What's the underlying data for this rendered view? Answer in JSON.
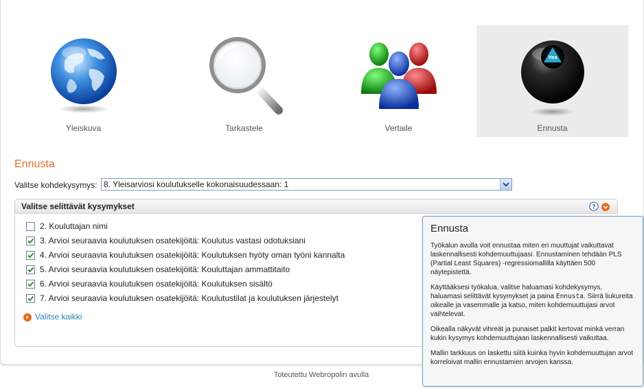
{
  "nav": [
    {
      "label": "Yleiskuva",
      "icon": "globe-icon",
      "active": false
    },
    {
      "label": "Tarkastele",
      "icon": "magnifier-icon",
      "active": false
    },
    {
      "label": "Vertaile",
      "icon": "people-icon",
      "active": false
    },
    {
      "label": "Ennusta",
      "icon": "eight-ball-icon",
      "active": true
    }
  ],
  "eight_ball_text": "Yes",
  "section_title": "Ennusta",
  "target": {
    "label": "Valitse kohdekysymys:",
    "selected": "8. Yleisarviosi koulutukselle kokonaisuudessaan: 1"
  },
  "questions_box": {
    "title": "Valitse selittävät kysymykset",
    "items": [
      {
        "label": "2. Kouluttajan nimi",
        "checked": false
      },
      {
        "label": "3. Arvioi seuraavia koulutuksen osatekijöitä: Koulutus vastasi odotuksiani",
        "checked": true
      },
      {
        "label": "4. Arvioi seuraavia koulutuksen osatekijöitä: Koulutuksen hyöty oman työni kannalta",
        "checked": true
      },
      {
        "label": "5. Arvioi seuraavia koulutuksen osatekijöitä: Kouluttajan ammattitaito",
        "checked": true
      },
      {
        "label": "6. Arvioi seuraavia koulutuksen osatekijöitä: Koulutuksen sisältö",
        "checked": true
      },
      {
        "label": "7. Arvioi seuraavia koulutuksen osatekijöitä: Koulutustilat ja koulutuksen järjestelyt",
        "checked": true
      }
    ],
    "select_all": "Valitse kaikki"
  },
  "footer": "Toteutettu Webropolin avulla",
  "tooltip": {
    "title": "Ennusta",
    "p1": "Työkalun avulla voit ennustaa miten eri muuttujat vaikuttavat laskennallisesti kohdemuuttujaasi. Ennustaminen tehdään PLS (Partial Least Squares) -regressiomallilla käyttäen 500 näytepistettä.",
    "p2_before": "Käyttääksesi työkalua, valitse haluamasi kohdekysymys, haluamasi selittävät kysymykset ja paina ",
    "p2_code": "Ennusta",
    "p2_after": ". Siirrä liukureita oikealle ja vasemmalle ja katso, miten kohdemuuttujasi arvot vaihtelevat.",
    "p3": "Oikealla näkyvät vihreät ja punaiset palkit kertovat minkä verran kukin kysymys kohdemuuttujaan laskennallisesti vaikuttaa.",
    "p4": "Mallin tarkkuus on laskettu siitä kuinka hyvin kohdemuuttujan arvot korreloivat mallin ennustamien arvojen kanssa."
  },
  "colors": {
    "accent_orange": "#e0702a",
    "link_blue": "#2a86b3",
    "check_green": "#2e8b2e",
    "tooltip_border": "#6f9db2"
  }
}
